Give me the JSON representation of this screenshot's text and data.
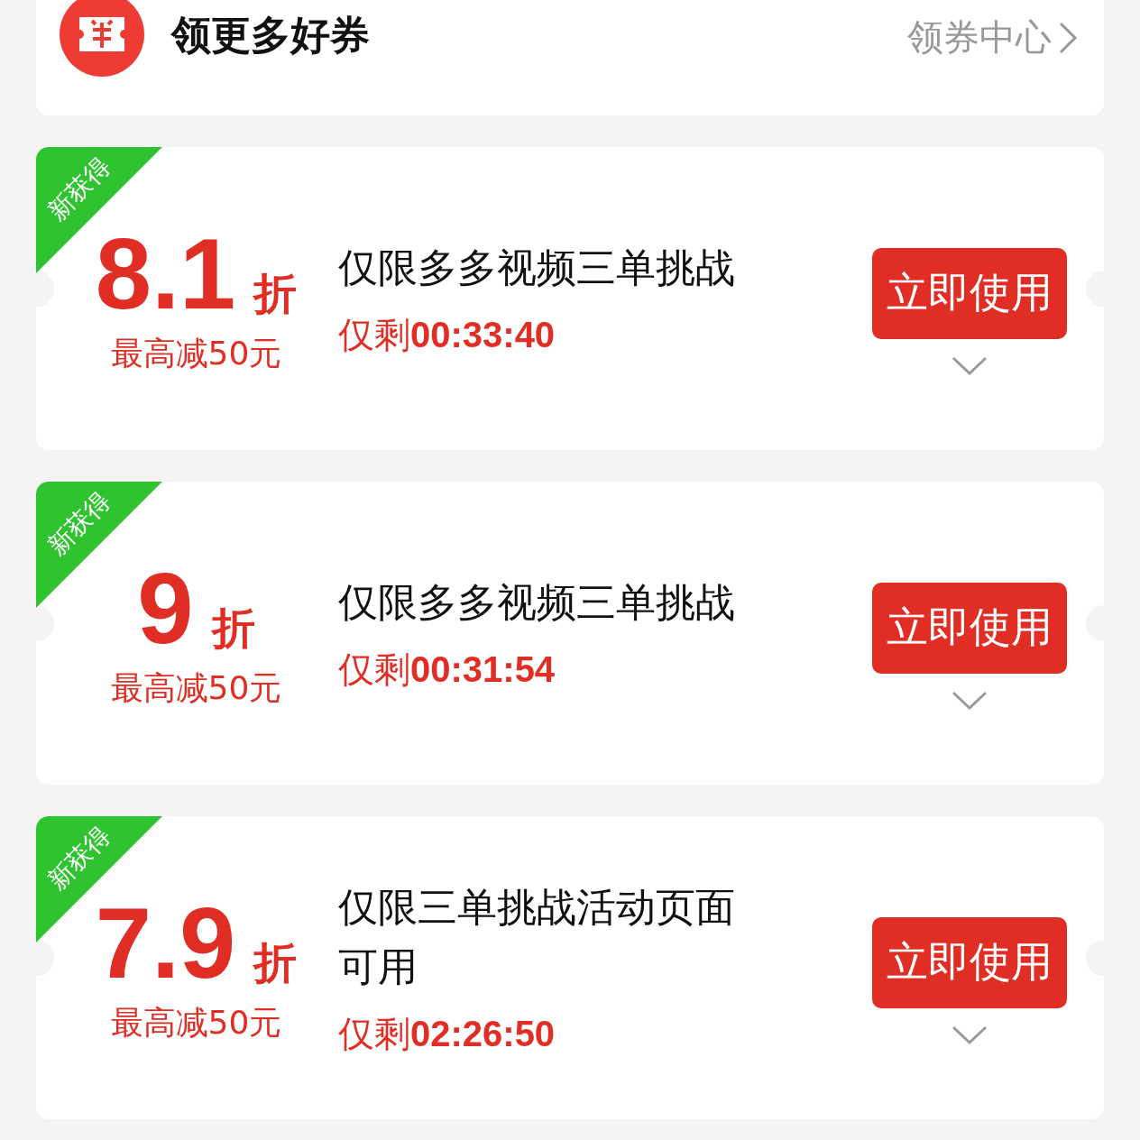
{
  "header": {
    "title": "领更多好券",
    "link": "领券中心"
  },
  "coupons": [
    {
      "badge": "新获得",
      "discount": "8.1",
      "unit": "折",
      "cap": "最高减50元",
      "title": "仅限多多视频三单挑战",
      "timer": "仅剩**00:33:40**",
      "button": "立即使用"
    },
    {
      "badge": "新获得",
      "discount": "9",
      "unit": "折",
      "cap": "最高减50元",
      "title": "仅限多多视频三单挑战",
      "timer": "仅剩**00:31:54**",
      "button": "立即使用"
    },
    {
      "badge": "新获得",
      "discount": "7.9",
      "unit": "折",
      "cap": "最高减50元",
      "title": "仅限三单挑战活动页面可用",
      "timer": "仅剩**02:26:50**",
      "button": "立即使用"
    }
  ]
}
